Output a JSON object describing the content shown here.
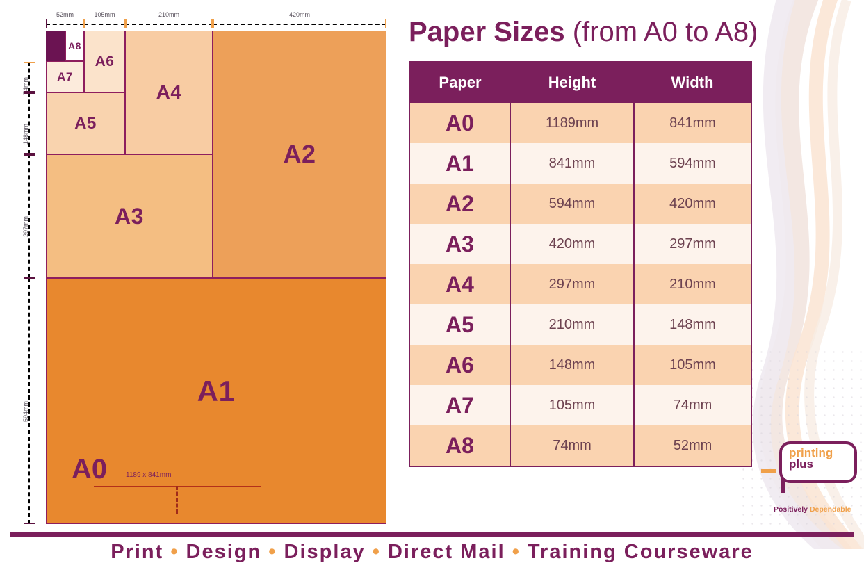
{
  "title": {
    "bold": "Paper Sizes",
    "normal": " (from A0 to A8)"
  },
  "table": {
    "headers": [
      "Paper",
      "Height",
      "Width"
    ],
    "rows": [
      {
        "paper": "A0",
        "height": "1189mm",
        "width": "841mm"
      },
      {
        "paper": "A1",
        "height": "841mm",
        "width": "594mm"
      },
      {
        "paper": "A2",
        "height": "594mm",
        "width": "420mm"
      },
      {
        "paper": "A3",
        "height": "420mm",
        "width": "297mm"
      },
      {
        "paper": "A4",
        "height": "297mm",
        "width": "210mm"
      },
      {
        "paper": "A5",
        "height": "210mm",
        "width": "148mm"
      },
      {
        "paper": "A6",
        "height": "148mm",
        "width": "105mm"
      },
      {
        "paper": "A7",
        "height": "105mm",
        "width": "74mm"
      },
      {
        "paper": "A8",
        "height": "74mm",
        "width": "52mm"
      }
    ]
  },
  "diagram": {
    "blocks": [
      {
        "id": "A1",
        "label": "A1",
        "color": "#E8882E"
      },
      {
        "id": "A2",
        "label": "A2",
        "color": "#EDA059"
      },
      {
        "id": "A3",
        "label": "A3",
        "color": "#F4BE82"
      },
      {
        "id": "A4",
        "label": "A4",
        "color": "#F8CCA3"
      },
      {
        "id": "A5",
        "label": "A5",
        "color": "#F9D3AE"
      },
      {
        "id": "A6",
        "label": "A6",
        "color": "#FBE3CB"
      },
      {
        "id": "A7",
        "label": "A7",
        "color": "#FCEBDC"
      },
      {
        "id": "A8",
        "label": "A8",
        "color": "#FFFFFF"
      }
    ],
    "a0_label": "A0",
    "a0_dimensions": "1189 x 841mm",
    "horizontal_rulers": [
      {
        "label": "52mm",
        "style": "purple"
      },
      {
        "label": "105mm",
        "style": "orange"
      },
      {
        "label": "210mm",
        "style": "purple"
      },
      {
        "label": "420mm",
        "style": "orange"
      }
    ],
    "vertical_rulers": [
      {
        "label": "74mm",
        "style": "orange"
      },
      {
        "label": "148mm",
        "style": "purple"
      },
      {
        "label": "297mm",
        "style": "orange"
      },
      {
        "label": "594mm",
        "style": "purple"
      }
    ]
  },
  "logo": {
    "line1": "printing",
    "line2": "plus",
    "tagline_purple": "Positively ",
    "tagline_orange": "Dependable"
  },
  "footer": {
    "items": [
      "Print",
      "Design",
      "Display",
      "Direct Mail",
      "Training Courseware"
    ],
    "separator": "•"
  },
  "colors": {
    "purple": "#7B1F5C",
    "deep_purple": "#6B1352",
    "orange": "#F0A04A",
    "a1_orange": "#E8882E",
    "row_odd": "#FAD3B0",
    "row_even": "#FDF3EC"
  }
}
